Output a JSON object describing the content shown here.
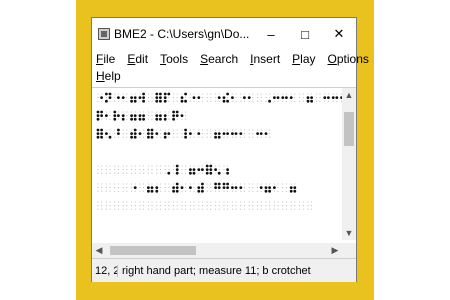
{
  "window": {
    "title": "BME2 - C:\\Users\\gn\\Do...",
    "minimize_glyph": "–",
    "maximize_glyph": "□",
    "close_glyph": "✕"
  },
  "menu": {
    "items": [
      {
        "underline": "F",
        "rest": "ile"
      },
      {
        "underline": "E",
        "rest": "dit"
      },
      {
        "underline": "T",
        "rest": "ools"
      },
      {
        "underline": "S",
        "rest": "earch"
      },
      {
        "underline": "I",
        "rest": "nsert"
      },
      {
        "underline": "P",
        "rest": "lay"
      },
      {
        "underline": "O",
        "rest": "ptions"
      },
      {
        "underline": "H",
        "rest": "elp"
      }
    ]
  },
  "scroll": {
    "up_glyph": "▲",
    "down_glyph": "▼",
    "left_glyph": "◀",
    "right_glyph": "▶"
  },
  "status": {
    "position": "12, 2",
    "message": "right hand part; measure 11; b crotchet"
  },
  "braille_lines": [
    "⠐⠝⠐⠂⠶⠺⠀⠿⠏⠀⠮⠐⠂⠀⠐⠮⠂⠐⠂⠀⠠⠒⠒⠂⠀⠶⠀⠒⠒⠒⠂",
    "⠟⠂⠗⠆⠶⠶⠀⠶⠆⠟⠂",
    "⠿⠢⠘⠀⠾⠂⠿⠂⠖⠀⠸⠂⠂⠀⠶⠒⠒⠂⠀⠒⠂",
    "",
    "⠀⠀⠀⠀⠀⠀⠀⠀⠠⠸⠀⠶⠒⠿⠢⠰",
    "⠀⠀⠀⠀⠐⠀⠶⠆⠀⠾⠂⠂⠾⠀⠛⠛⠒⠂⠀⠐⠶⠂⠀⠶",
    "⠀⠀⠀⠀⠀⠀⠀⠀⠀⠀⠀⠀⠀⠀⠀⠀⠀⠀⠀⠀⠀⠀⠀⠀⠀⠀"
  ]
}
